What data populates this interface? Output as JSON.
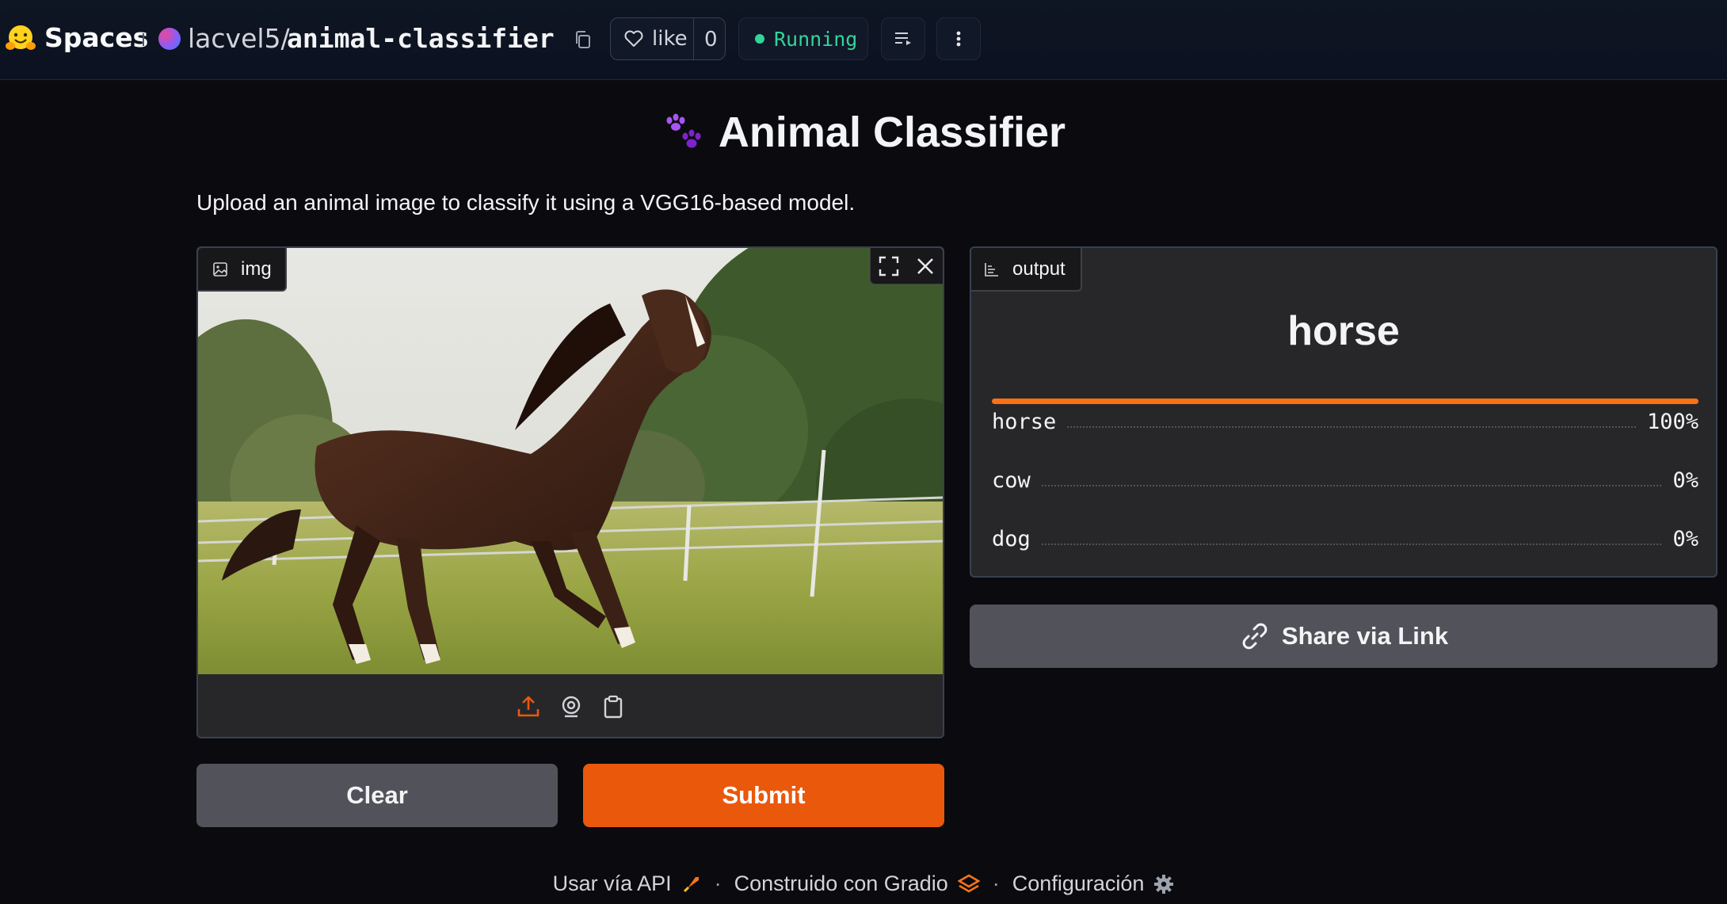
{
  "header": {
    "spaces_label": "Spaces",
    "owner": "lacvel5/",
    "repo": "animal-classifier",
    "like_label": "like",
    "like_count": "0",
    "status": "Running"
  },
  "app": {
    "title": "Animal Classifier",
    "description": "Upload an animal image to classify it using a VGG16-based model."
  },
  "input_panel": {
    "label": "img"
  },
  "buttons": {
    "clear": "Clear",
    "submit": "Submit",
    "share": "Share via Link"
  },
  "output_panel": {
    "label": "output",
    "prediction": "horse",
    "confidences": [
      {
        "label": "horse",
        "value": "100%",
        "fraction": 1.0
      },
      {
        "label": "cow",
        "value": "0%",
        "fraction": 0.0
      },
      {
        "label": "dog",
        "value": "0%",
        "fraction": 0.0
      }
    ]
  },
  "footer": {
    "api": "Usar vía API",
    "built": "Construido con Gradio",
    "settings": "Configuración"
  },
  "colors": {
    "accent": "#ea580c",
    "running": "#34d399",
    "bar": "#f97316"
  }
}
